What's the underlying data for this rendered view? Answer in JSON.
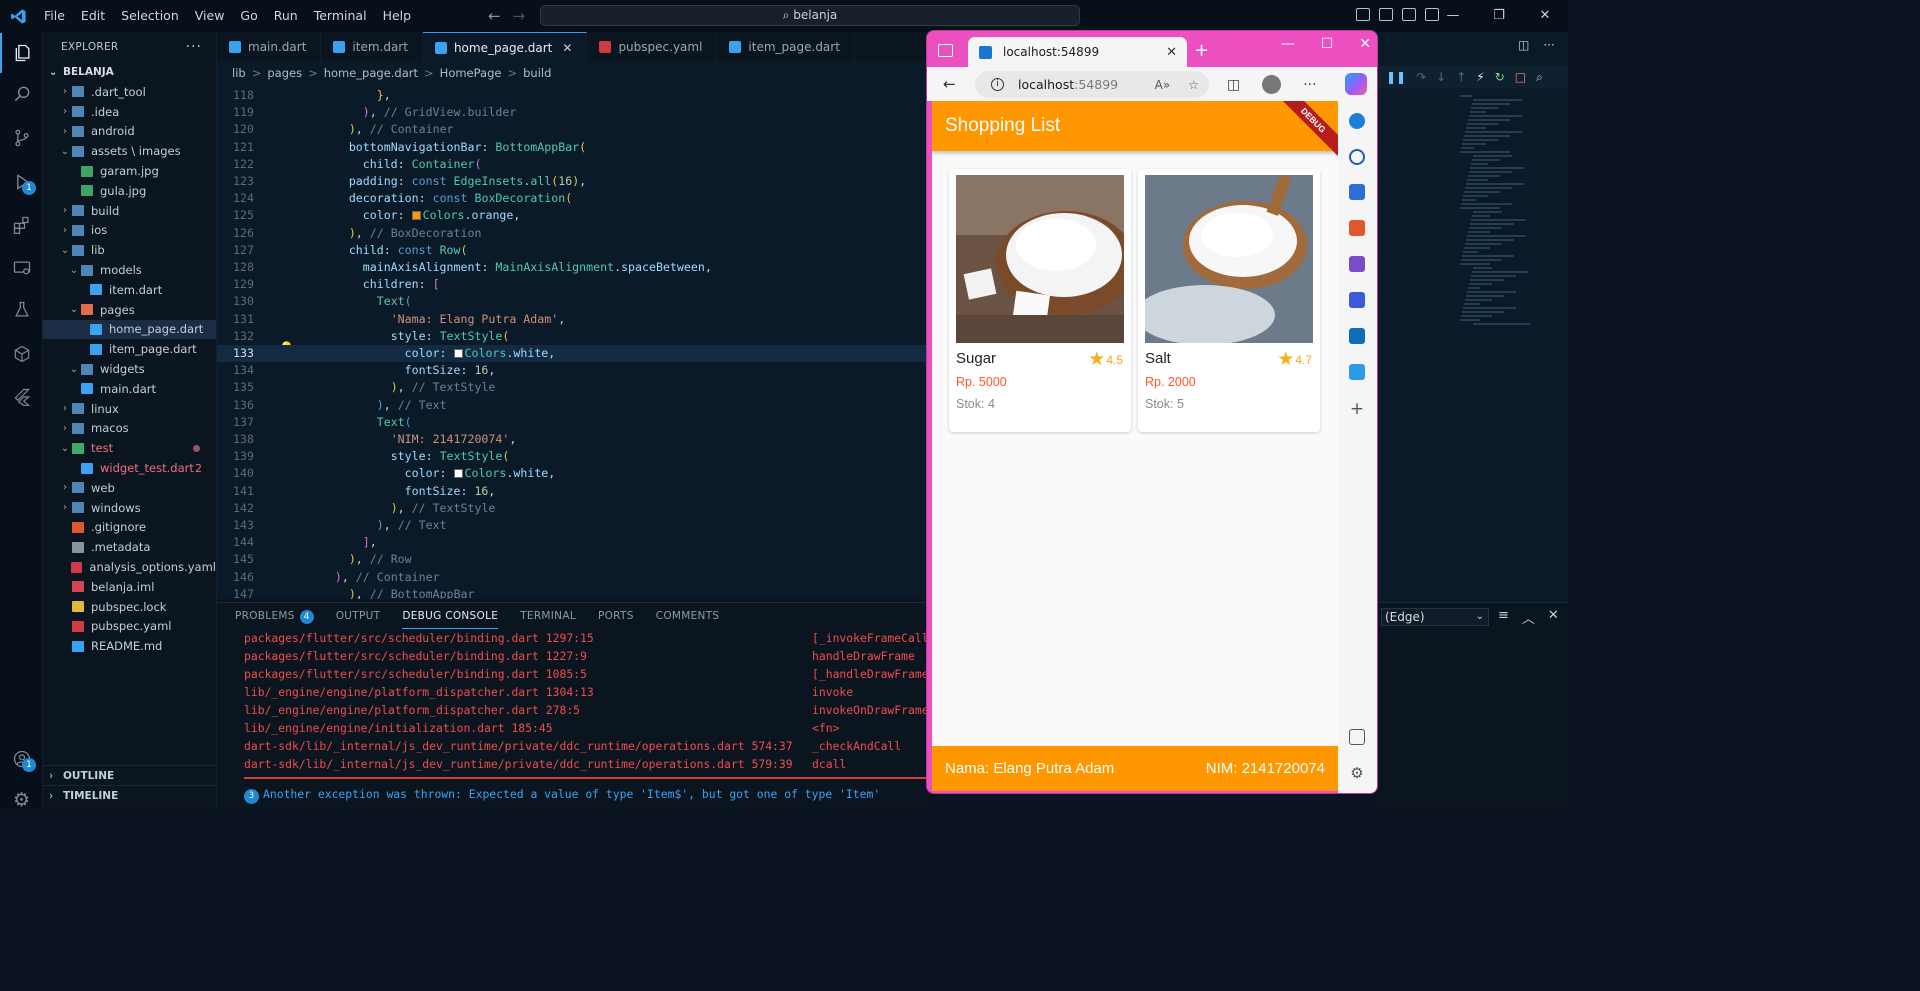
{
  "titlebar": {
    "menu": [
      "File",
      "Edit",
      "Selection",
      "View",
      "Go",
      "Run",
      "Terminal",
      "Help"
    ],
    "search": "belanja"
  },
  "explorer": {
    "title": "EXPLORER",
    "root": "BELANJA",
    "items": [
      {
        "label": ".dart_tool",
        "type": "folder",
        "depth": 1,
        "open": false
      },
      {
        "label": ".idea",
        "type": "folder",
        "depth": 1,
        "open": false
      },
      {
        "label": "android",
        "type": "folder",
        "depth": 1,
        "open": false
      },
      {
        "label": "assets \\ images",
        "type": "folder",
        "depth": 1,
        "open": true
      },
      {
        "label": "garam.jpg",
        "type": "image",
        "depth": 2
      },
      {
        "label": "gula.jpg",
        "type": "image",
        "depth": 2
      },
      {
        "label": "build",
        "type": "folder",
        "depth": 1,
        "open": false
      },
      {
        "label": "ios",
        "type": "folder",
        "depth": 1,
        "open": false
      },
      {
        "label": "lib",
        "type": "folder",
        "depth": 1,
        "open": true
      },
      {
        "label": "models",
        "type": "folder",
        "depth": 2,
        "open": true
      },
      {
        "label": "item.dart",
        "type": "dart",
        "depth": 3
      },
      {
        "label": "pages",
        "type": "folder",
        "depth": 2,
        "open": true
      },
      {
        "label": "home_page.dart",
        "type": "dart",
        "depth": 3,
        "selected": true
      },
      {
        "label": "item_page.dart",
        "type": "dart",
        "depth": 3
      },
      {
        "label": "widgets",
        "type": "folder",
        "depth": 2,
        "open": true
      },
      {
        "label": "main.dart",
        "type": "dart",
        "depth": 2
      },
      {
        "label": "linux",
        "type": "folder",
        "depth": 1,
        "open": false
      },
      {
        "label": "macos",
        "type": "folder",
        "depth": 1,
        "open": false
      },
      {
        "label": "test",
        "type": "folder",
        "depth": 1,
        "open": true,
        "error": true
      },
      {
        "label": "widget_test.dart",
        "type": "dart",
        "depth": 2,
        "error": true,
        "badge": "2"
      },
      {
        "label": "web",
        "type": "folder",
        "depth": 1,
        "open": false
      },
      {
        "label": "windows",
        "type": "folder",
        "depth": 1,
        "open": false
      },
      {
        "label": ".gitignore",
        "type": "git",
        "depth": 1
      },
      {
        "label": ".metadata",
        "type": "file",
        "depth": 1
      },
      {
        "label": "analysis_options.yaml",
        "type": "yaml",
        "depth": 1
      },
      {
        "label": "belanja.iml",
        "type": "iml",
        "depth": 1
      },
      {
        "label": "pubspec.lock",
        "type": "lock",
        "depth": 1
      },
      {
        "label": "pubspec.yaml",
        "type": "yaml",
        "depth": 1
      },
      {
        "label": "README.md",
        "type": "md",
        "depth": 1
      }
    ],
    "outline": "OUTLINE",
    "timeline": "TIMELINE"
  },
  "editor": {
    "tabs": [
      {
        "label": "main.dart",
        "icon": "dart"
      },
      {
        "label": "item.dart",
        "icon": "dart"
      },
      {
        "label": "home_page.dart",
        "icon": "dart",
        "active": true
      },
      {
        "label": "pubspec.yaml",
        "icon": "yaml"
      },
      {
        "label": "item_page.dart",
        "icon": "dart"
      }
    ],
    "breadcrumbs": [
      "lib",
      ">",
      "pages",
      ">",
      "home_page.dart",
      ">",
      "HomePage",
      ">",
      "build"
    ],
    "current_line": 133,
    "lines": [
      {
        "n": 118,
        "tokens": [
          [
            "              ",
            "p"
          ],
          [
            "}",
            "b"
          ],
          [
            ",",
            "p"
          ]
        ]
      },
      {
        "n": 119,
        "tokens": [
          [
            "            ",
            "p"
          ],
          [
            ")",
            "b2"
          ],
          [
            ", ",
            "p"
          ],
          [
            "// GridView.builder",
            "c"
          ]
        ]
      },
      {
        "n": 120,
        "tokens": [
          [
            "          ",
            "p"
          ],
          [
            ")",
            "b"
          ],
          [
            ", ",
            "p"
          ],
          [
            "// Container",
            "c"
          ]
        ]
      },
      {
        "n": 121,
        "tokens": [
          [
            "          ",
            "p"
          ],
          [
            "bottomNavigationBar",
            "v"
          ],
          [
            ": ",
            "p"
          ],
          [
            "BottomAppBar",
            "t"
          ],
          [
            "(",
            "b"
          ]
        ]
      },
      {
        "n": 122,
        "tokens": [
          [
            "            ",
            "p"
          ],
          [
            "child",
            "v"
          ],
          [
            ": ",
            "p"
          ],
          [
            "Container",
            "t"
          ],
          [
            "(",
            "b2"
          ]
        ]
      },
      {
        "n": 123,
        "tokens": [
          [
            "          ",
            "p"
          ],
          [
            "padding",
            "v"
          ],
          [
            ": ",
            "p"
          ],
          [
            "const ",
            "k"
          ],
          [
            "EdgeInsets",
            "t"
          ],
          [
            ".",
            "p"
          ],
          [
            "all",
            "t"
          ],
          [
            "(",
            "b"
          ],
          [
            "16",
            "n"
          ],
          [
            ")",
            "b"
          ],
          [
            ",",
            "p"
          ]
        ]
      },
      {
        "n": 124,
        "tokens": [
          [
            "          ",
            "p"
          ],
          [
            "decoration",
            "v"
          ],
          [
            ": ",
            "p"
          ],
          [
            "const ",
            "k"
          ],
          [
            "BoxDecoration",
            "t"
          ],
          [
            "(",
            "b"
          ]
        ]
      },
      {
        "n": 125,
        "tokens": [
          [
            "            ",
            "p"
          ],
          [
            "color",
            "v"
          ],
          [
            ": ",
            "p"
          ],
          [
            "#ff9800",
            "sw"
          ],
          [
            "Colors",
            "t"
          ],
          [
            ".",
            "p"
          ],
          [
            "orange",
            "v"
          ],
          [
            ",",
            "p"
          ]
        ]
      },
      {
        "n": 126,
        "tokens": [
          [
            "          ",
            "p"
          ],
          [
            ")",
            "b"
          ],
          [
            ", ",
            "p"
          ],
          [
            "// BoxDecoration",
            "c"
          ]
        ]
      },
      {
        "n": 127,
        "tokens": [
          [
            "          ",
            "p"
          ],
          [
            "child",
            "v"
          ],
          [
            ": ",
            "p"
          ],
          [
            "const ",
            "k"
          ],
          [
            "Row",
            "t"
          ],
          [
            "(",
            "b"
          ]
        ]
      },
      {
        "n": 128,
        "tokens": [
          [
            "            ",
            "p"
          ],
          [
            "mainAxisAlignment",
            "v"
          ],
          [
            ": ",
            "p"
          ],
          [
            "MainAxisAlignment",
            "t"
          ],
          [
            ".",
            "p"
          ],
          [
            "spaceBetween",
            "v"
          ],
          [
            ",",
            "p"
          ]
        ]
      },
      {
        "n": 129,
        "tokens": [
          [
            "            ",
            "p"
          ],
          [
            "children",
            "v"
          ],
          [
            ": ",
            "p"
          ],
          [
            "[",
            "b2"
          ]
        ]
      },
      {
        "n": 130,
        "tokens": [
          [
            "              ",
            "p"
          ],
          [
            "Text",
            "t"
          ],
          [
            "(",
            "k"
          ]
        ]
      },
      {
        "n": 131,
        "tokens": [
          [
            "                ",
            "p"
          ],
          [
            "'Nama: Elang Putra Adam'",
            "s"
          ],
          [
            ",",
            "p"
          ]
        ]
      },
      {
        "n": 132,
        "tokens": [
          [
            "                ",
            "p"
          ],
          [
            "style",
            "v"
          ],
          [
            ": ",
            "p"
          ],
          [
            "TextStyle",
            "t"
          ],
          [
            "(",
            "b"
          ]
        ]
      },
      {
        "n": 133,
        "tokens": [
          [
            "                  ",
            "p"
          ],
          [
            "color",
            "v"
          ],
          [
            ": ",
            "p"
          ],
          [
            "#ffffff",
            "sw"
          ],
          [
            "Colors",
            "t"
          ],
          [
            ".",
            "p"
          ],
          [
            "white",
            "v"
          ],
          [
            ",",
            "p"
          ]
        ]
      },
      {
        "n": 134,
        "tokens": [
          [
            "                  ",
            "p"
          ],
          [
            "fontSize",
            "v"
          ],
          [
            ": ",
            "p"
          ],
          [
            "16",
            "n"
          ],
          [
            ",",
            "p"
          ]
        ]
      },
      {
        "n": 135,
        "tokens": [
          [
            "                ",
            "p"
          ],
          [
            ")",
            "b"
          ],
          [
            ", ",
            "p"
          ],
          [
            "// TextStyle",
            "c"
          ]
        ]
      },
      {
        "n": 136,
        "tokens": [
          [
            "              ",
            "p"
          ],
          [
            ")",
            "k"
          ],
          [
            ", ",
            "p"
          ],
          [
            "// Text",
            "c"
          ]
        ]
      },
      {
        "n": 137,
        "tokens": [
          [
            "              ",
            "p"
          ],
          [
            "Text",
            "t"
          ],
          [
            "(",
            "k"
          ]
        ]
      },
      {
        "n": 138,
        "tokens": [
          [
            "                ",
            "p"
          ],
          [
            "'NIM: 2141720074'",
            "s"
          ],
          [
            ",",
            "p"
          ]
        ]
      },
      {
        "n": 139,
        "tokens": [
          [
            "                ",
            "p"
          ],
          [
            "style",
            "v"
          ],
          [
            ": ",
            "p"
          ],
          [
            "TextStyle",
            "t"
          ],
          [
            "(",
            "b"
          ]
        ]
      },
      {
        "n": 140,
        "tokens": [
          [
            "                  ",
            "p"
          ],
          [
            "color",
            "v"
          ],
          [
            ": ",
            "p"
          ],
          [
            "#ffffff",
            "sw"
          ],
          [
            "Colors",
            "t"
          ],
          [
            ".",
            "p"
          ],
          [
            "white",
            "v"
          ],
          [
            ",",
            "p"
          ]
        ]
      },
      {
        "n": 141,
        "tokens": [
          [
            "                  ",
            "p"
          ],
          [
            "fontSize",
            "v"
          ],
          [
            ": ",
            "p"
          ],
          [
            "16",
            "n"
          ],
          [
            ",",
            "p"
          ]
        ]
      },
      {
        "n": 142,
        "tokens": [
          [
            "                ",
            "p"
          ],
          [
            ")",
            "b"
          ],
          [
            ", ",
            "p"
          ],
          [
            "// TextStyle",
            "c"
          ]
        ]
      },
      {
        "n": 143,
        "tokens": [
          [
            "              ",
            "p"
          ],
          [
            ")",
            "k"
          ],
          [
            ", ",
            "p"
          ],
          [
            "// Text",
            "c"
          ]
        ]
      },
      {
        "n": 144,
        "tokens": [
          [
            "            ",
            "p"
          ],
          [
            "]",
            "b2"
          ],
          [
            ",",
            "p"
          ]
        ]
      },
      {
        "n": 145,
        "tokens": [
          [
            "          ",
            "p"
          ],
          [
            ")",
            "b"
          ],
          [
            ", ",
            "p"
          ],
          [
            "// Row",
            "c"
          ]
        ]
      },
      {
        "n": 146,
        "tokens": [
          [
            "        ",
            "p"
          ],
          [
            ")",
            "b2"
          ],
          [
            ", ",
            "p"
          ],
          [
            "// Container",
            "c"
          ]
        ]
      },
      {
        "n": 147,
        "tokens": [
          [
            "          ",
            "p"
          ],
          [
            ")",
            "b"
          ],
          [
            ", ",
            "p"
          ],
          [
            "// BottomAppBar",
            "c"
          ]
        ]
      }
    ]
  },
  "panel": {
    "tabs": [
      {
        "label": "PROBLEMS",
        "badge": "4"
      },
      {
        "label": "OUTPUT"
      },
      {
        "label": "DEBUG CONSOLE",
        "active": true
      },
      {
        "label": "TERMINAL"
      },
      {
        "label": "PORTS"
      },
      {
        "label": "COMMENTS"
      }
    ],
    "console": [
      {
        "left": "packages/flutter/src/scheduler/binding.dart 1297:15",
        "right": "[_invokeFrameCall"
      },
      {
        "left": "packages/flutter/src/scheduler/binding.dart 1227:9",
        "right": "handleDrawFrame"
      },
      {
        "left": "packages/flutter/src/scheduler/binding.dart 1085:5",
        "right": "[_handleDrawFrame"
      },
      {
        "left": "lib/_engine/engine/platform_dispatcher.dart 1304:13",
        "right": "invoke"
      },
      {
        "left": "lib/_engine/engine/platform_dispatcher.dart 278:5",
        "right": "invokeOnDrawFrame"
      },
      {
        "left": "lib/_engine/engine/initialization.dart 185:45",
        "right": "<fn>"
      },
      {
        "left": "dart-sdk/lib/_internal/js_dev_runtime/private/ddc_runtime/operations.dart 574:37",
        "right": "_checkAndCall"
      },
      {
        "left": "dart-sdk/lib/_internal/js_dev_runtime/private/ddc_runtime/operations.dart 579:39",
        "right": "dcall"
      }
    ],
    "exception_count": "3",
    "exception": "Another exception was thrown: Expected a value of type 'Item$', but got one of type 'Item'",
    "debug_target": "(Edge)"
  },
  "browser": {
    "tab_title": "localhost:54899",
    "url_host": "localhost",
    "url_port": ":54899",
    "app": {
      "title": "Shopping List",
      "debug_banner": "DEBUG",
      "items": [
        {
          "name": "Sugar",
          "rating": "4.5",
          "price": "Rp. 5000",
          "stock": "Stok: 4",
          "image": "sugar"
        },
        {
          "name": "Salt",
          "rating": "4.7",
          "price": "Rp. 2000",
          "stock": "Stok: 5",
          "image": "salt"
        }
      ],
      "footer_left": "Nama: Elang Putra Adam",
      "footer_right": "NIM: 2141720074"
    }
  },
  "colors": {
    "accent": "#3aa2f0",
    "orange": "#ff9800",
    "error": "#f14c4c",
    "browser_frame": "#ec4fc0"
  }
}
